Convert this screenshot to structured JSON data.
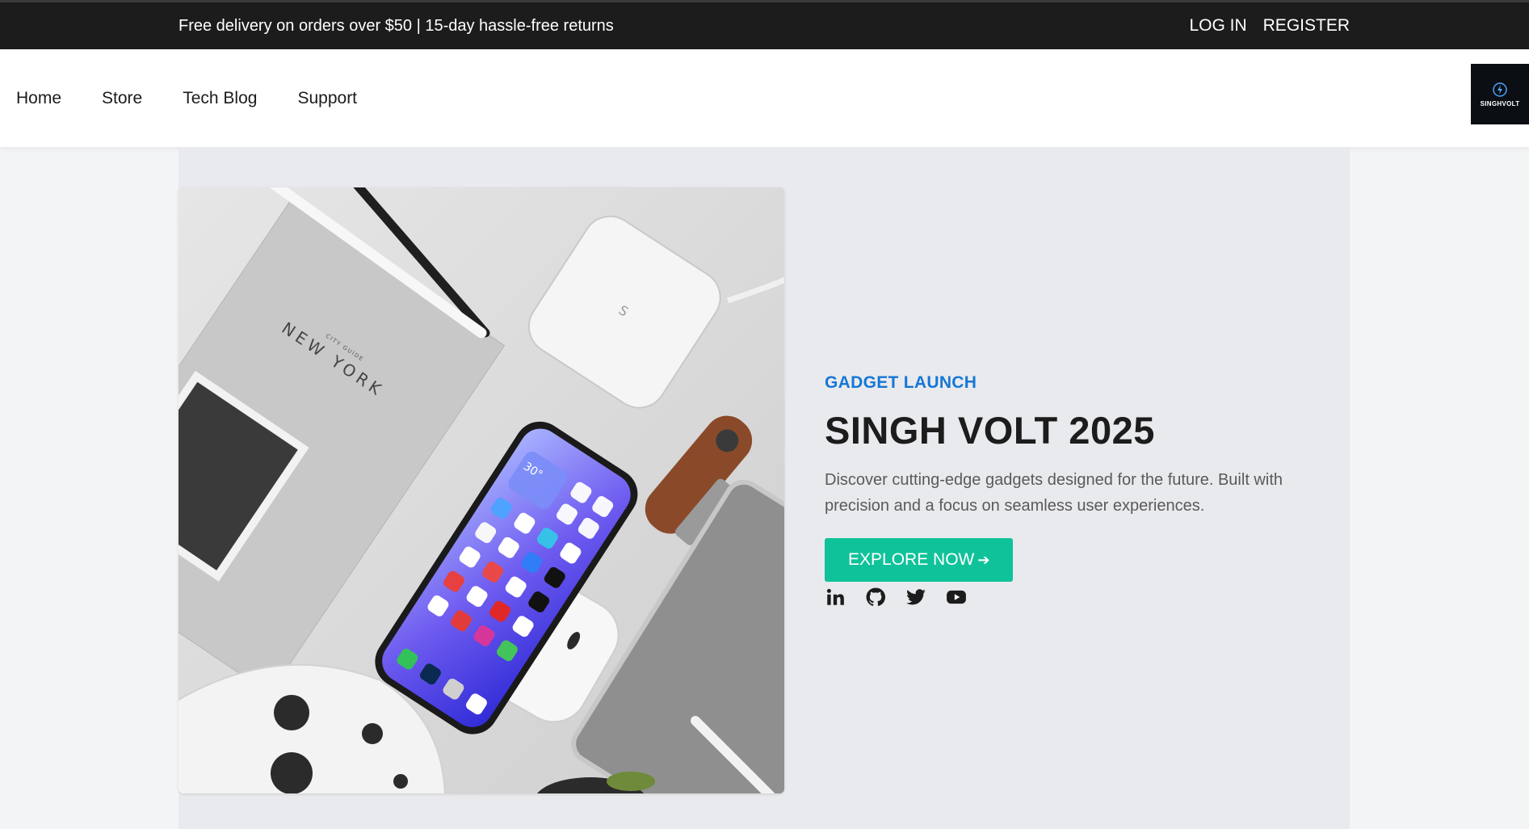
{
  "topbar": {
    "promo": "Free delivery on orders over $50 | 15-day hassle-free returns",
    "login": "LOG IN",
    "register": "REGISTER"
  },
  "nav": {
    "items": [
      "Home",
      "Store",
      "Tech Blog",
      "Support"
    ]
  },
  "logo": {
    "text": "SINGHVOLT"
  },
  "hero": {
    "kicker": "GADGET LAUNCH",
    "title": "SINGH VOLT 2025",
    "description": "Discover cutting-edge gadgets designed for the future. Built with precision and a focus on seamless user experiences.",
    "cta": "EXPLORE NOW",
    "cta_icon": "arrow-right-icon",
    "image_text": {
      "book_title": "NEW YORK",
      "book_subtitle": "CITY GUIDE",
      "phone_widget": "30°"
    },
    "socials": [
      "linkedin-icon",
      "github-icon",
      "twitter-icon",
      "youtube-icon"
    ]
  },
  "colors": {
    "topbar_bg": "#1c1c1c",
    "accent_blue": "#1677d6",
    "cta_green": "#10c29a",
    "hero_bg": "#e9eaed"
  }
}
